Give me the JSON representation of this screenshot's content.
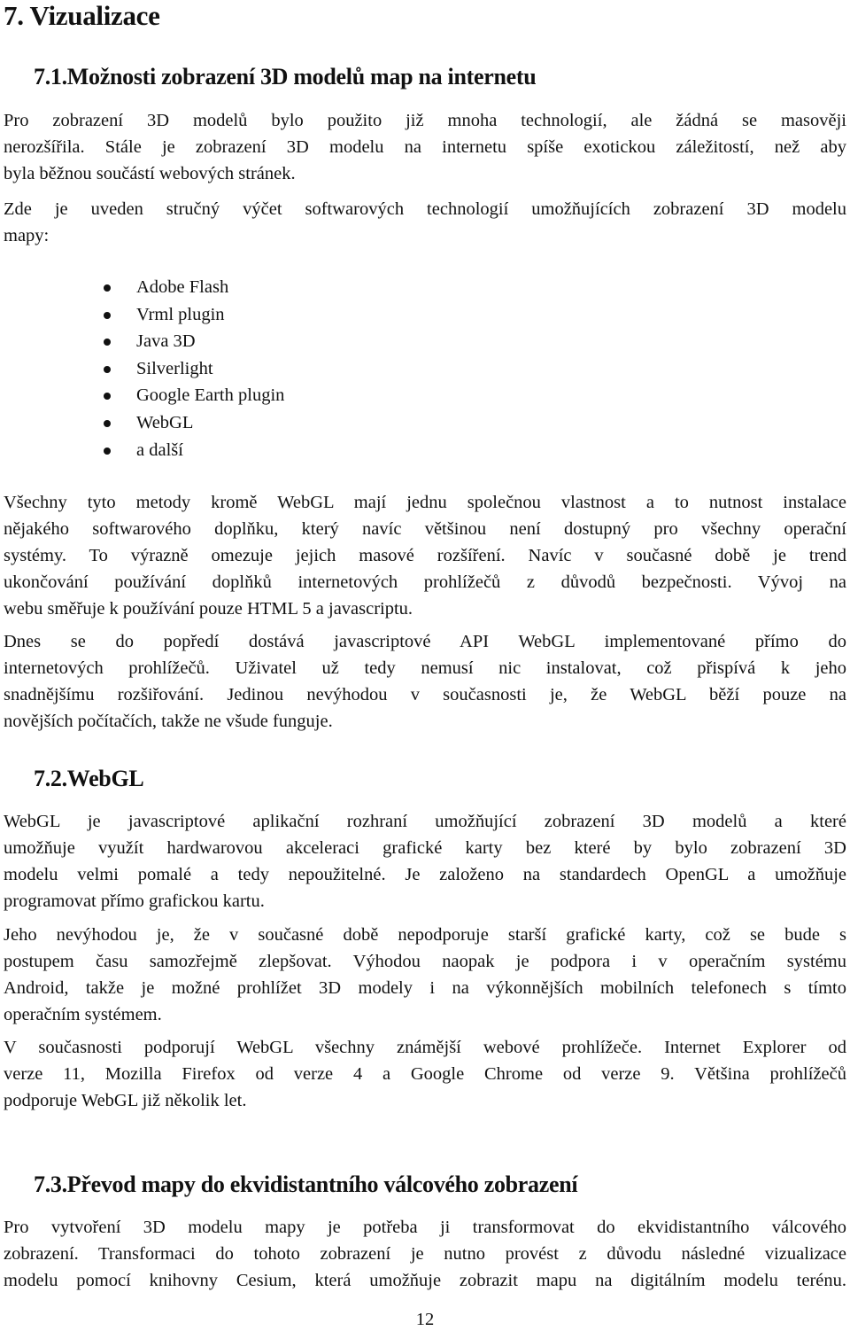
{
  "chapter": {
    "title": "7. Vizualizace"
  },
  "sections": [
    {
      "heading": "7.1.Možnosti zobrazení 3D modelů map na internetu",
      "p1": [
        "Pro zobrazení 3D modelů bylo použito již mnoha technologií, ale žádná se masověji",
        "nerozšířila. Stále je zobrazení 3D modelu na internetu spíše exotickou záležitostí, než aby",
        "byla běžnou součástí webových stránek."
      ],
      "p2": [
        "Zde je uveden stručný výčet softwarových technologií umožňujících zobrazení 3D modelu",
        "mapy:"
      ],
      "list": [
        "Adobe Flash",
        "Vrml plugin",
        "Java 3D",
        "Silverlight",
        "Google Earth plugin",
        "WebGL",
        "a další"
      ],
      "p3": [
        "Všechny tyto metody kromě WebGL mají jednu společnou vlastnost a to nutnost instalace",
        "nějakého softwarového doplňku, který navíc většinou není dostupný pro všechny operační",
        "systémy. To výrazně omezuje jejich masové rozšíření. Navíc v současné době je trend",
        "ukončování používání doplňků internetových prohlížečů z důvodů bezpečnosti. Vývoj na",
        "webu směřuje k používání pouze HTML 5 a javascriptu."
      ],
      "p4": [
        "Dnes se do popředí dostává javascriptové API WebGL implementované přímo do",
        "internetových prohlížečů. Uživatel už tedy nemusí nic instalovat, což přispívá k jeho",
        "snadnějšímu rozšiřování. Jedinou nevýhodou v současnosti je, že WebGL běží pouze na",
        "novějších počítačích, takže ne všude funguje."
      ]
    },
    {
      "heading": "7.2.WebGL",
      "p1": [
        "WebGL je javascriptové aplikační rozhraní umožňující zobrazení 3D modelů a které",
        "umožňuje využít hardwarovou akceleraci grafické karty bez které by bylo zobrazení 3D",
        "modelu velmi pomalé a tedy nepoužitelné. Je založeno na standardech OpenGL a umožňuje",
        "programovat přímo grafickou kartu."
      ],
      "p2": [
        "Jeho nevýhodou je, že v současné době nepodporuje starší grafické karty, což se bude s",
        "postupem času samozřejmě zlepšovat. Výhodou naopak je podpora i v operačním systému",
        "Android, takže je možné prohlížet 3D modely i na výkonnějších mobilních telefonech s tímto",
        "operačním systémem."
      ],
      "p3": [
        "V současnosti podporují WebGL všechny známější webové prohlížeče. Internet Explorer od",
        "verze 11, Mozilla Firefox od verze 4 a Google Chrome od verze 9. Většina prohlížečů",
        "podporuje WebGL již několik let."
      ]
    },
    {
      "heading": "7.3.Převod mapy do ekvidistantního válcového zobrazení",
      "p1": [
        "Pro vytvoření 3D modelu mapy je potřeba ji transformovat do ekvidistantního válcového",
        "zobrazení. Transformaci do tohoto zobrazení je nutno provést z důvodu následné vizualizace",
        "modelu pomocí knihovny Cesium, která umožňuje zobrazit mapu na digitálním modelu terénu."
      ]
    }
  ],
  "footer": {
    "page_number": "12"
  }
}
